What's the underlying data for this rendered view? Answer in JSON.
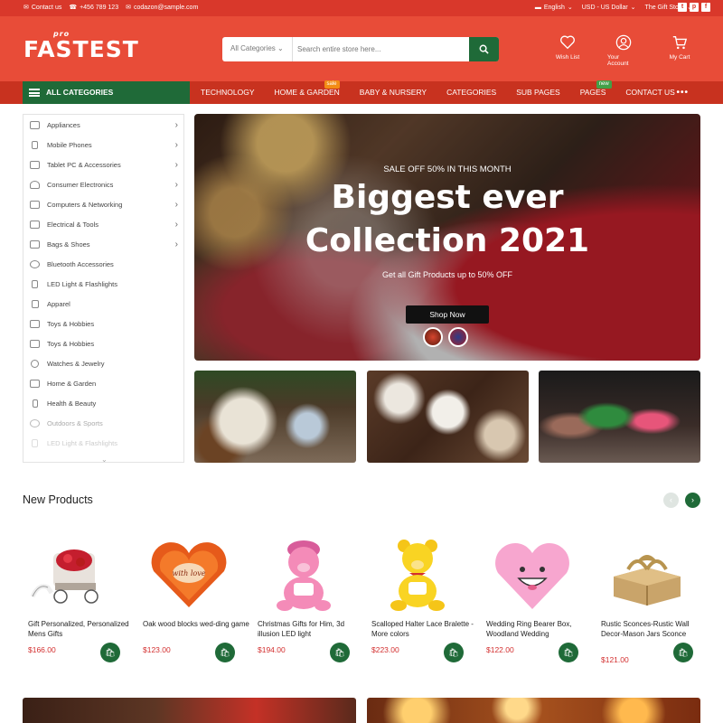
{
  "topbar": {
    "contact_us": "Contact us",
    "phone": "+456 789 123",
    "email": "codazon@sample.com",
    "language": "English",
    "currency": "USD - US Dollar",
    "store": "The Gift Store",
    "social": [
      "t",
      "p",
      "f"
    ]
  },
  "header": {
    "logo": "FASTEST",
    "logo_badge": "pro",
    "search": {
      "category": "All Categories",
      "placeholder": "Search entire store here..."
    },
    "icons": [
      {
        "label": "Wish List",
        "icon": "heart-icon"
      },
      {
        "label": "Your Account",
        "icon": "user-icon"
      },
      {
        "label": "My Cart",
        "icon": "cart-icon"
      }
    ]
  },
  "nav": {
    "all_categories": "ALL CATEGORIES",
    "links": [
      "TECHNOLOGY",
      "HOME & GARDEN",
      "BABY & NURSERY",
      "CATEGORIES",
      "SUB PAGES",
      "PAGES",
      "CONTACT US"
    ],
    "badges": {
      "sale": "sale",
      "new": "new"
    },
    "more": "•••"
  },
  "sidebar": {
    "items": [
      {
        "label": "Appliances",
        "arrow": "›"
      },
      {
        "label": "Mobile Phones",
        "arrow": "›"
      },
      {
        "label": "Tablet PC & Accessories",
        "arrow": "›"
      },
      {
        "label": "Consumer Electronics",
        "arrow": "›"
      },
      {
        "label": "Computers & Networking",
        "arrow": "›"
      },
      {
        "label": "Electrical & Tools",
        "arrow": "›"
      },
      {
        "label": "Bags & Shoes",
        "arrow": "›"
      },
      {
        "label": "Bluetooth Accessories"
      },
      {
        "label": "LED Light & Flashlights"
      },
      {
        "label": "Apparel"
      },
      {
        "label": "Toys & Hobbies"
      },
      {
        "label": "Toys & Hobbies"
      },
      {
        "label": "Watches & Jewelry"
      },
      {
        "label": "Home & Garden"
      },
      {
        "label": "Health & Beauty"
      },
      {
        "label": "Outdoors & Sports"
      },
      {
        "label": "LED Light & Flashlights"
      }
    ]
  },
  "hero": {
    "kicker": "SALE OFF 50% IN THIS MONTH",
    "title_line1": "Biggest ever",
    "title_line2": "Collection 2021",
    "subtitle": "Get all Gift Products up to 50% OFF",
    "button": "Shop Now"
  },
  "new_products": {
    "title": "New Products",
    "items": [
      {
        "name": "Gift Personalized, Personalized Mens Gifts",
        "price": "$166.00"
      },
      {
        "name": "Oak wood blocks wed-ding game",
        "price": "$123.00"
      },
      {
        "name": "Christmas Gifts for Him, 3d illusion LED light",
        "price": "$194.00"
      },
      {
        "name": "Scalloped Halter Lace Bralette - More colors",
        "price": "$223.00"
      },
      {
        "name": "Wedding Ring Bearer Box, Woodland Wedding",
        "price": "$122.00"
      },
      {
        "name": "Rustic Sconces-Rustic Wall Decor-Mason Jars Sconce",
        "price": "$121.00"
      }
    ]
  },
  "colors": {
    "brand_red": "#e84c38",
    "nav_red": "#c8321f",
    "brand_green": "#1f6a38",
    "price_red": "#d32f2f"
  }
}
